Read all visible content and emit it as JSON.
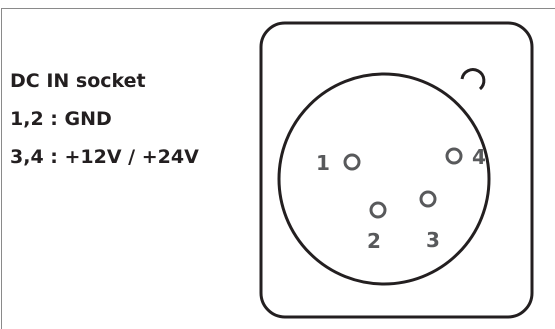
{
  "title": "DC IN socket",
  "pinout": [
    {
      "pins": "1,2",
      "separator": " : ",
      "signal": "GND"
    },
    {
      "pins": "3,4",
      "separator": " : ",
      "signal": "+12V / +24V"
    }
  ],
  "pin_numbers": {
    "p1": "1",
    "p2": "2",
    "p3": "3",
    "p4": "4"
  },
  "colors": {
    "outline": "#231f20",
    "pin_text": "#58595b",
    "border": "#8a8a8a"
  }
}
